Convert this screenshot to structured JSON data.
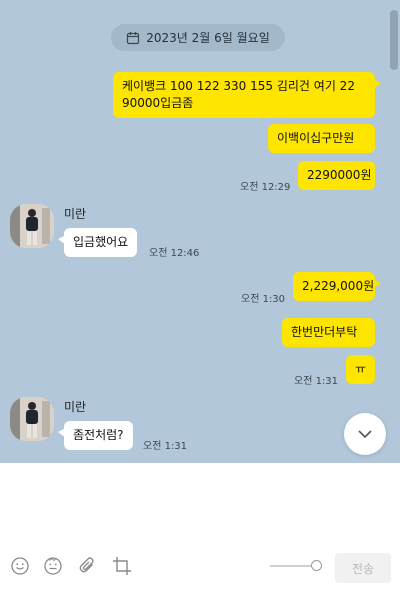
{
  "date_separator": "2023년 2월 6일 월요일",
  "messages": {
    "m1_line1": "케이뱅크 100 122 330 155 김리건 여기 22",
    "m1_line2": "90000입금좀",
    "m2": "이백이십구만원",
    "m3": "2290000원",
    "m3_time": "오전 12:29",
    "m4_sender": "미란",
    "m4": "입금했어요",
    "m4_time": "오전 12:46",
    "m5": "2,229,000원",
    "m5_time": "오전 1:30",
    "m6": "한번만더부탁",
    "m7": "ㅠ",
    "m7_time": "오전 1:31",
    "m8_sender": "미란",
    "m8": "좀전처럼?",
    "m8_time": "오전 1:31"
  },
  "composer": {
    "send_label": "전송"
  },
  "icons": [
    "calendar-icon",
    "emoji-icon",
    "sticker-icon",
    "attach-icon",
    "crop-icon",
    "chevron-down-icon"
  ],
  "colors": {
    "chat_bg": "#b2c7da",
    "my_bubble": "#fee500",
    "their_bubble": "#ffffff"
  }
}
